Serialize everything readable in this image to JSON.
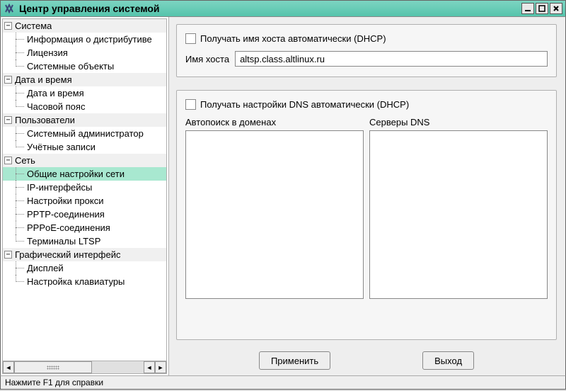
{
  "window": {
    "title": "Центр управления системой"
  },
  "tree": {
    "categories": [
      {
        "label": "Система",
        "items": [
          {
            "label": "Информация о дистрибутиве"
          },
          {
            "label": "Лицензия"
          },
          {
            "label": "Системные объекты"
          }
        ]
      },
      {
        "label": "Дата и время",
        "items": [
          {
            "label": "Дата и время"
          },
          {
            "label": "Часовой пояс"
          }
        ]
      },
      {
        "label": "Пользователи",
        "items": [
          {
            "label": "Системный администратор"
          },
          {
            "label": "Учётные записи"
          }
        ]
      },
      {
        "label": "Сеть",
        "items": [
          {
            "label": "Общие настройки сети",
            "selected": true
          },
          {
            "label": "IP-интерфейсы"
          },
          {
            "label": "Настройки прокси"
          },
          {
            "label": "PPTP-соединения"
          },
          {
            "label": "PPPoE-соединения"
          },
          {
            "label": "Терминалы LTSP"
          }
        ]
      },
      {
        "label": "Графический интерфейс",
        "items": [
          {
            "label": "Дисплей"
          },
          {
            "label": "Настройка клавиатуры"
          }
        ]
      }
    ]
  },
  "main": {
    "dhcp_host_label": "Получать имя хоста автоматически (DHCP)",
    "hostname_label": "Имя хоста",
    "hostname_value": "altsp.class.altlinux.ru",
    "dhcp_dns_label": "Получать настройки DNS автоматически (DHCP)",
    "search_domains_label": "Автопоиск в доменах",
    "dns_servers_label": "Серверы DNS",
    "apply_label": "Применить",
    "exit_label": "Выход"
  },
  "status": {
    "help_text": "Нажмите F1 для справки"
  }
}
